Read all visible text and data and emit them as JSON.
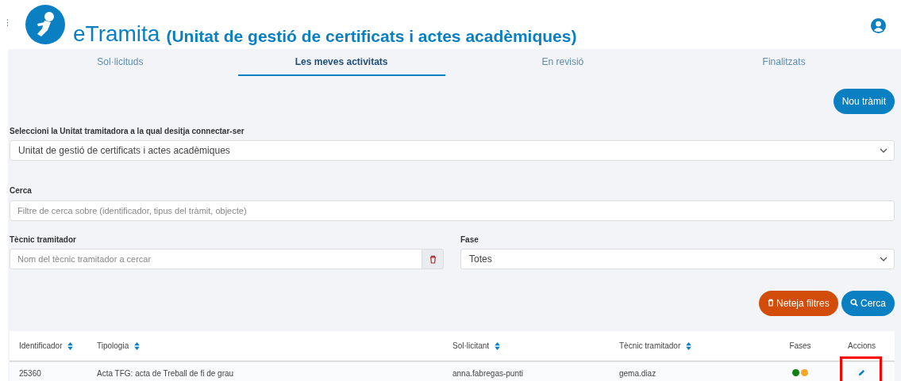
{
  "header": {
    "app_name": "eTramita",
    "unit_name": "(Unitat de gestió de certificats i actes acadèmiques)"
  },
  "tabs": [
    {
      "label": "Sol·licituds",
      "selected": false
    },
    {
      "label": "Les meves activitats",
      "selected": true
    },
    {
      "label": "En revisió",
      "selected": false
    },
    {
      "label": "Finalitzats",
      "selected": false
    }
  ],
  "new_button": "Nou tràmit",
  "unit_select": {
    "label": "Seleccioni la Unitat tramitadora a la qual desitja connectar-ser",
    "value": "Unitat de gestió de certificats i actes acadèmiques"
  },
  "search": {
    "label": "Cerca",
    "placeholder": "Filtre de cerca sobre (identificador, tipus del tràmit, objecte)"
  },
  "technician": {
    "label": "Tècnic tramitador",
    "placeholder": "Nom del tècnic tramitador a cercar"
  },
  "phase": {
    "label": "Fase",
    "value": "Totes"
  },
  "clear_button": "Neteja filtres",
  "search_button": "Cerca",
  "table": {
    "columns": [
      {
        "label": "Identificador",
        "sortable": true
      },
      {
        "label": "Tipologia",
        "sortable": true
      },
      {
        "label": "Sol·licitant",
        "sortable": true
      },
      {
        "label": "Tècnic tramitador",
        "sortable": true
      },
      {
        "label": "Fases",
        "sortable": false
      },
      {
        "label": "Accions",
        "sortable": false
      }
    ],
    "rows": [
      {
        "id": "25360",
        "type": "Acta TFG: acta de Treball de fi de grau",
        "applicant": "anna.fabregas-punti",
        "technician": "gema.diaz",
        "phases": [
          {
            "color": "#108010"
          },
          {
            "color": "#f5a623"
          }
        ],
        "highlighted": true
      }
    ]
  }
}
